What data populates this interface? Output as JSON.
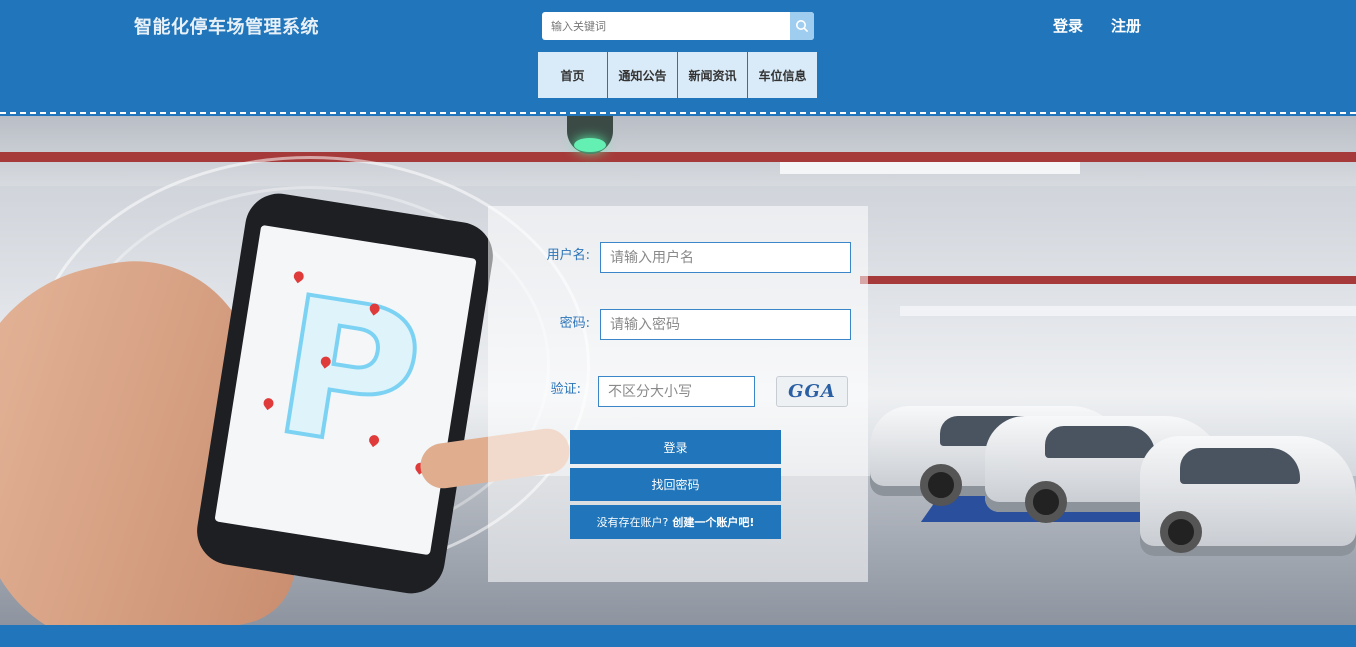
{
  "header": {
    "brand": "智能化停车场管理系统",
    "search": {
      "placeholder": "输入关键词"
    },
    "login_link": "登录",
    "register_link": "注册"
  },
  "nav": {
    "items": [
      {
        "label": "首页"
      },
      {
        "label": "通知公告"
      },
      {
        "label": "新闻资讯"
      },
      {
        "label": "车位信息"
      }
    ]
  },
  "login_form": {
    "username": {
      "label": "用户名:",
      "placeholder": "请输入用户名"
    },
    "password": {
      "label": "密码:",
      "placeholder": "请输入密码"
    },
    "captcha": {
      "label": "验证:",
      "placeholder": "不区分大小写",
      "code": "GGA"
    },
    "login_button": "登录",
    "recover_button": "找回密码",
    "register_prompt": "没有存在账户?",
    "register_link": "创建一个账户吧!"
  },
  "colors": {
    "primary": "#2176bb",
    "nav_bg": "#d9ebf9",
    "label": "#2c74b8"
  }
}
